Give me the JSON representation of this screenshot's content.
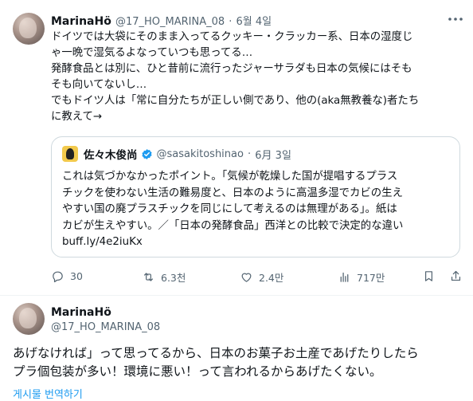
{
  "tweet1": {
    "display_name": "MarinaHö",
    "handle": "@17_HO_MARINA_08",
    "separator": "·",
    "date": "6월 4일",
    "more_icon": "more-horizontal-icon",
    "text_lines": [
      "ドイツでは大袋にそのまま入ってるクッキー・クラッカー系、日本の湿度じ",
      "ゃ一晩で湿気るよなっていつも思ってる…",
      "発酵食品とは別に、ひと昔前に流行ったジャーサラダも日本の気候にはそも",
      "そも向いてないし…",
      "でもドイツ人は「常に自分たちが正しい側であり、他の(aka無教養な)者たち",
      "に教えて→"
    ],
    "quote": {
      "display_name": "佐々木俊尚",
      "handle": "@sasakitoshinao",
      "separator": "·",
      "date": "6月 3일",
      "verified_color": "#1d9bf0",
      "text_lines": [
        "これは気づかなかったポイント。「気候が乾燥した国が提唱するプラス",
        "チックを使わない生活の難易度と、日本のように高温多湿でカビの生え",
        "やすい国の廃プラスチックを同じにして考えるのは無理がある」。紙は",
        "カビが生えやすい。／「日本の発酵食品」西洋との比較で決定的な違い",
        "buff.ly/4e2iuKx"
      ]
    },
    "actions": {
      "replies": "30",
      "reposts": "6.3천",
      "likes": "2.4만",
      "views": "717만"
    }
  },
  "tweet2": {
    "display_name": "MarinaHö",
    "handle": "@17_HO_MARINA_08",
    "text_lines": [
      "あげなければ」って思ってるから、日本のお菓子お土産であげたりしたら",
      "プラ個包装が多い！環境に悪い！って言われるからあげたくない。"
    ],
    "translate_label": "게시물 번역하기"
  },
  "colors": {
    "text": "#0f1419",
    "muted": "#536471",
    "link": "#1d9bf0",
    "border": "#cfd9de"
  }
}
